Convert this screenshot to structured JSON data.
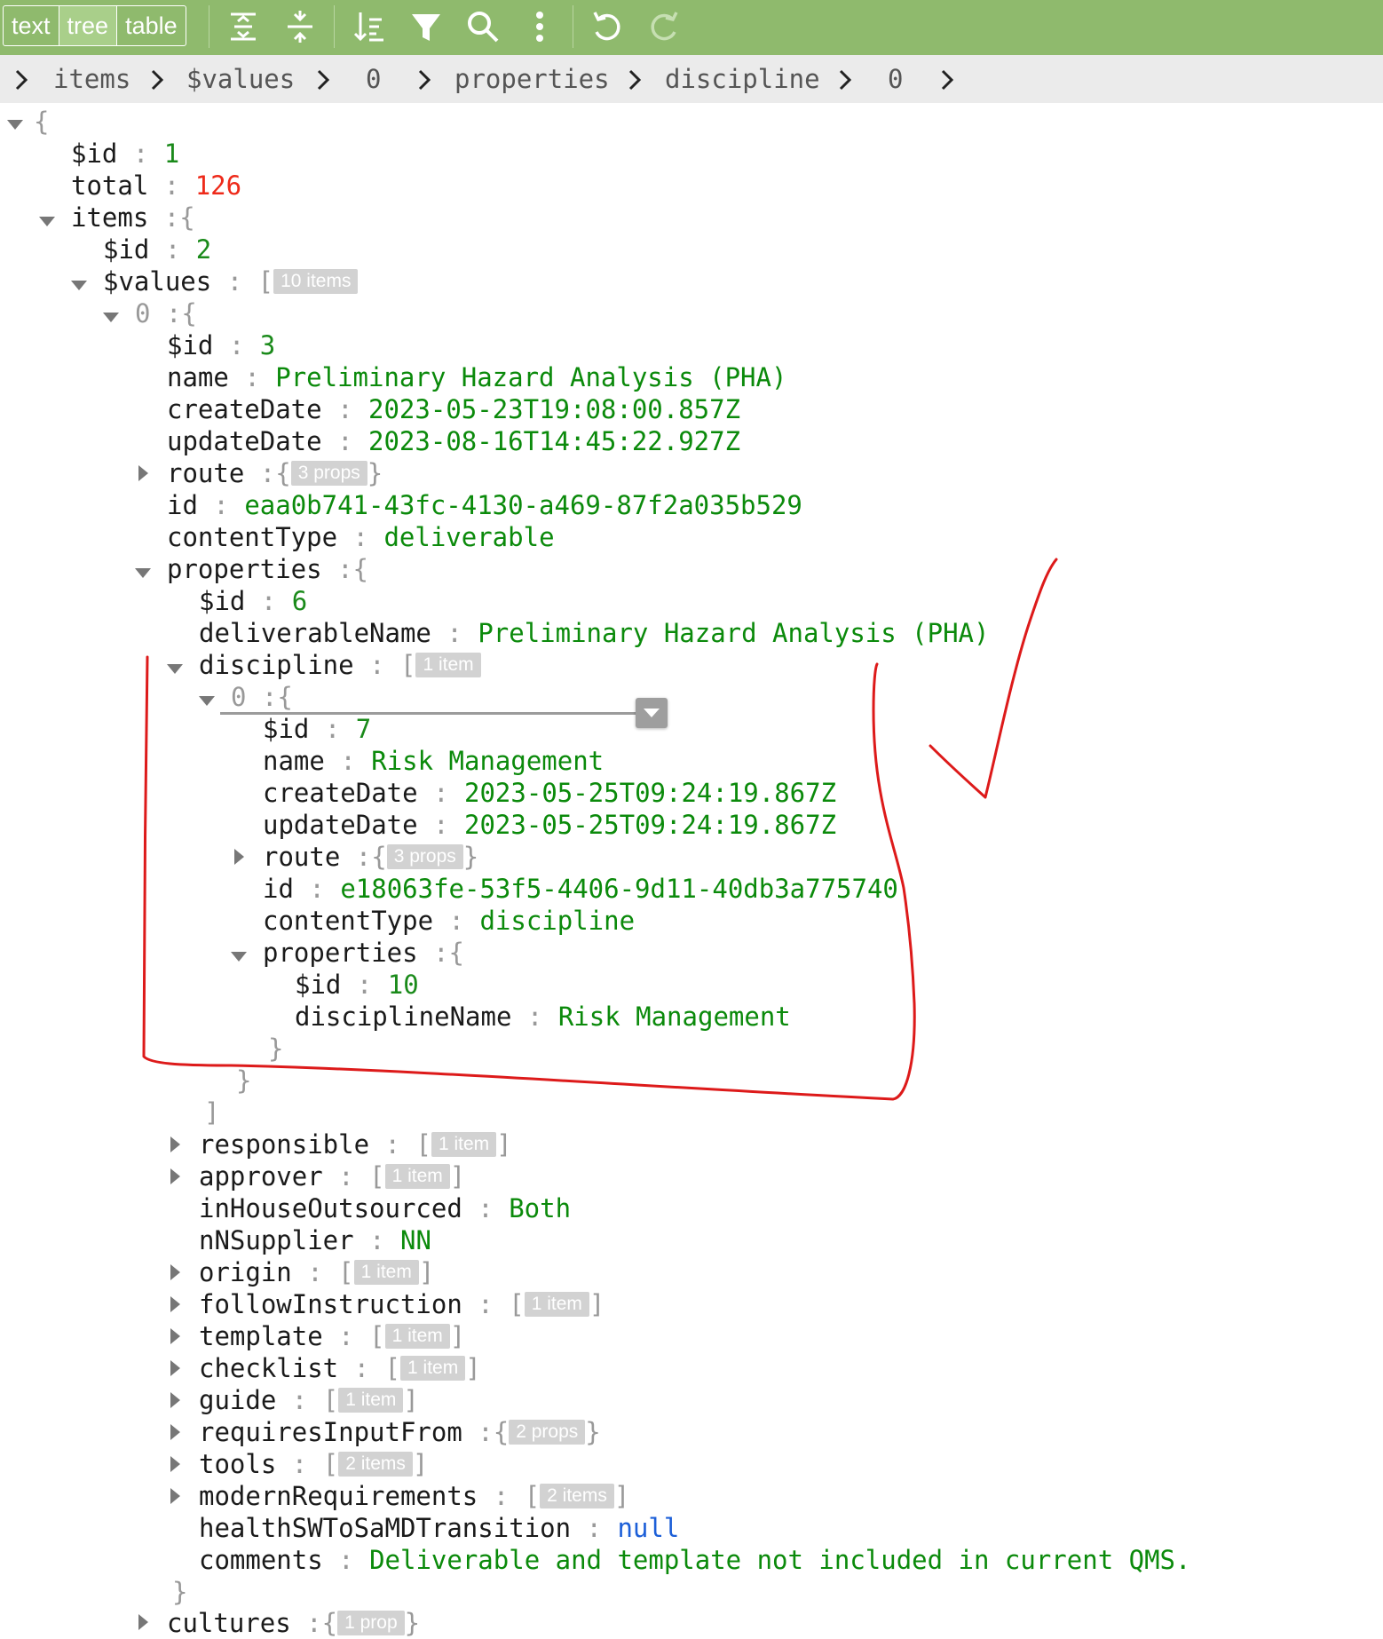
{
  "toolbar": {
    "modes": [
      "text",
      "tree",
      "table"
    ],
    "active_mode": "tree",
    "icons": [
      "expand-all-icon",
      "collapse-all-icon",
      "sort-icon",
      "filter-icon",
      "search-icon",
      "more-icon",
      "undo-icon",
      "redo-icon"
    ]
  },
  "breadcrumb": [
    "items",
    "$values",
    "0",
    "properties",
    "discipline",
    "0"
  ],
  "tree": {
    "root_open": "{",
    "id1": {
      "key": "$id",
      "value": "1"
    },
    "total": {
      "key": "total",
      "value": "126"
    },
    "items": {
      "key": "items",
      "open": "{"
    },
    "id2": {
      "key": "$id",
      "value": "2"
    },
    "values": {
      "key": "$values",
      "open": "[",
      "badge": "10 items"
    },
    "v0": {
      "key": "0",
      "open": "{"
    },
    "id3": {
      "key": "$id",
      "value": "3"
    },
    "name": {
      "key": "name",
      "value": "Preliminary Hazard Analysis (PHA)"
    },
    "createDate": {
      "key": "createDate",
      "value": "2023-05-23T19:08:00.857Z"
    },
    "updateDate": {
      "key": "updateDate",
      "value": "2023-08-16T14:45:22.927Z"
    },
    "route": {
      "key": "route",
      "open": "{",
      "badge": "3 props",
      "close": "}"
    },
    "id": {
      "key": "id",
      "value": "eaa0b741-43fc-4130-a469-87f2a035b529"
    },
    "contentType": {
      "key": "contentType",
      "value": "deliverable"
    },
    "properties": {
      "key": "properties",
      "open": "{"
    },
    "id6": {
      "key": "$id",
      "value": "6"
    },
    "deliverableName": {
      "key": "deliverableName",
      "value": "Preliminary Hazard Analysis (PHA)"
    },
    "discipline": {
      "key": "discipline",
      "open": "[",
      "badge": "1 item"
    },
    "d0": {
      "key": "0",
      "open": "{"
    },
    "id7": {
      "key": "$id",
      "value": "7"
    },
    "dname": {
      "key": "name",
      "value": "Risk Management"
    },
    "dcreate": {
      "key": "createDate",
      "value": "2023-05-25T09:24:19.867Z"
    },
    "dupdate": {
      "key": "updateDate",
      "value": "2023-05-25T09:24:19.867Z"
    },
    "droute": {
      "key": "route",
      "open": "{",
      "badge": "3 props",
      "close": "}"
    },
    "did": {
      "key": "id",
      "value": "e18063fe-53f5-4406-9d11-40db3a775740"
    },
    "dctype": {
      "key": "contentType",
      "value": "discipline"
    },
    "dprops": {
      "key": "properties",
      "open": "{"
    },
    "id10": {
      "key": "$id",
      "value": "10"
    },
    "disciplineName": {
      "key": "disciplineName",
      "value": "Risk Management"
    },
    "close_brace": "}",
    "close_bracket": "]",
    "responsible": {
      "key": "responsible",
      "open": "[",
      "badge": "1 item",
      "close": "]"
    },
    "approver": {
      "key": "approver",
      "open": "[",
      "badge": "1 item",
      "close": "]"
    },
    "inHouseOutsourced": {
      "key": "inHouseOutsourced",
      "value": "Both"
    },
    "nNSupplier": {
      "key": "nNSupplier",
      "value": "NN"
    },
    "origin": {
      "key": "origin",
      "open": "[",
      "badge": "1 item",
      "close": "]"
    },
    "followInstruction": {
      "key": "followInstruction",
      "open": "[",
      "badge": "1 item",
      "close": "]"
    },
    "template": {
      "key": "template",
      "open": "[",
      "badge": "1 item",
      "close": "]"
    },
    "checklist": {
      "key": "checklist",
      "open": "[",
      "badge": "1 item",
      "close": "]"
    },
    "guide": {
      "key": "guide",
      "open": "[",
      "badge": "1 item",
      "close": "]"
    },
    "requiresInputFrom": {
      "key": "requiresInputFrom",
      "open": "{",
      "badge": "2 props",
      "close": "}"
    },
    "tools": {
      "key": "tools",
      "open": "[",
      "badge": "2 items",
      "close": "]"
    },
    "modernRequirements": {
      "key": "modernRequirements",
      "open": "[",
      "badge": "2 items",
      "close": "]"
    },
    "healthSWToSaMDTransition": {
      "key": "healthSWToSaMDTransition",
      "value": "null"
    },
    "comments": {
      "key": "comments",
      "value": "Deliverable and template not included in current QMS."
    },
    "cultures": {
      "key": "cultures",
      "open": "{",
      "badge": "1 prop",
      "close": "}"
    }
  },
  "colors": {
    "toolbar": "#8fba6d",
    "string": "#0b8a0b",
    "number": "#1a8a1a",
    "number_highlight": "#ee2a1a",
    "null": "#1c5fd8",
    "annotation": "#dd1a1a"
  }
}
